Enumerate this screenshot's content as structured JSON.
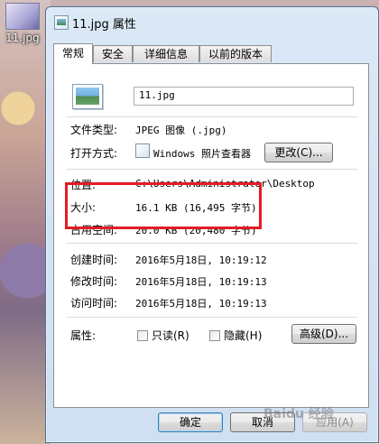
{
  "desktop": {
    "icon_label": "11.jpg"
  },
  "window": {
    "title": "11.jpg 属性"
  },
  "tabs": [
    {
      "label": "常规"
    },
    {
      "label": "安全"
    },
    {
      "label": "详细信息"
    },
    {
      "label": "以前的版本"
    }
  ],
  "general": {
    "file_name": "11.jpg",
    "file_type_label": "文件类型:",
    "file_type_value": "JPEG 图像 (.jpg)",
    "open_with_label": "打开方式:",
    "open_with_value": "Windows 照片查看器",
    "change_button": "更改(C)...",
    "location_label": "位置:",
    "location_value": "C:\\Users\\Administrator\\Desktop",
    "size_label": "大小:",
    "size_value": "16.1 KB (16,495 字节)",
    "size_on_disk_label": "占用空间:",
    "size_on_disk_value": "20.0 KB (20,480 字节)",
    "created_label": "创建时间:",
    "created_value": "2016年5月18日, 10:19:12",
    "modified_label": "修改时间:",
    "modified_value": "2016年5月18日, 10:19:13",
    "accessed_label": "访问时间:",
    "accessed_value": "2016年5月18日, 10:19:13",
    "attributes_label": "属性:",
    "readonly_label": "只读(R)",
    "hidden_label": "隐藏(H)",
    "advanced_button": "高级(D)..."
  },
  "footer": {
    "ok": "确定",
    "cancel": "取消",
    "apply": "应用(A)"
  },
  "watermark": "Baidu 经验"
}
